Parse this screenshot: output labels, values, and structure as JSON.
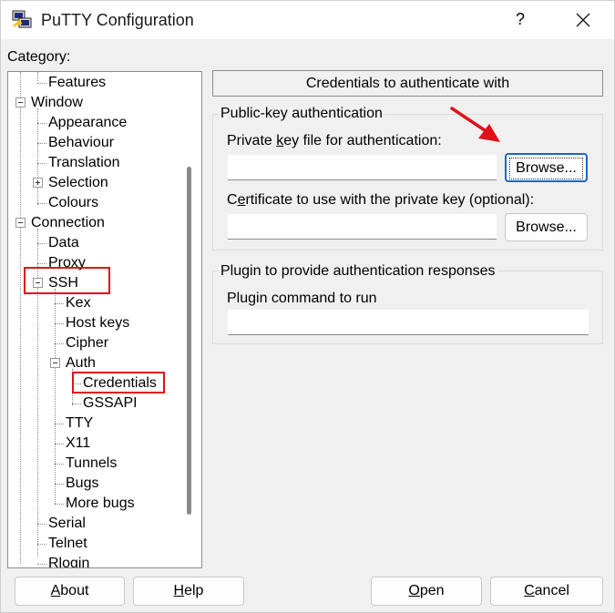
{
  "window": {
    "title": "PuTTY Configuration",
    "help_glyph": "?",
    "accent_color": "#1a66c7",
    "highlight_color": "#e0101a"
  },
  "category": {
    "label": "Category:",
    "tree": [
      {
        "label": "Features"
      },
      {
        "label": "Window",
        "expander": "minus"
      },
      {
        "label": "Appearance"
      },
      {
        "label": "Behaviour"
      },
      {
        "label": "Translation"
      },
      {
        "label": "Selection",
        "expander": "plus"
      },
      {
        "label": "Colours"
      },
      {
        "label": "Connection",
        "expander": "minus"
      },
      {
        "label": "Data"
      },
      {
        "label": "Proxy"
      },
      {
        "label": "SSH",
        "expander": "minus",
        "highlighted": true
      },
      {
        "label": "Kex"
      },
      {
        "label": "Host keys"
      },
      {
        "label": "Cipher"
      },
      {
        "label": "Auth",
        "expander": "minus"
      },
      {
        "label": "Credentials",
        "selected": true,
        "highlighted": true
      },
      {
        "label": "GSSAPI"
      },
      {
        "label": "TTY"
      },
      {
        "label": "X11"
      },
      {
        "label": "Tunnels"
      },
      {
        "label": "Bugs"
      },
      {
        "label": "More bugs"
      },
      {
        "label": "Serial"
      },
      {
        "label": "Telnet"
      },
      {
        "label": "Rlogin"
      }
    ]
  },
  "panel": {
    "header": "Credentials to authenticate with",
    "pubkey_group": {
      "title": "Public-key authentication",
      "private_key_label_pre": "Private ",
      "private_key_label_acc": "k",
      "private_key_label_post": "ey file for authentication:",
      "private_key_value": "",
      "browse1_label": "Browse...",
      "cert_label_pre": "C",
      "cert_label_acc": "e",
      "cert_label_post": "rtificate to use with the private key (optional):",
      "cert_value": "",
      "browse2_label": "Browse..."
    },
    "plugin_group": {
      "title": "Plugin to provide authentication responses",
      "command_label": "Plugin command to run",
      "command_value": ""
    }
  },
  "footer": {
    "about_acc": "A",
    "about_rest": "bout",
    "help_acc": "H",
    "help_rest": "elp",
    "open_acc": "O",
    "open_rest": "pen",
    "cancel_acc": "C",
    "cancel_rest": "ancel"
  }
}
